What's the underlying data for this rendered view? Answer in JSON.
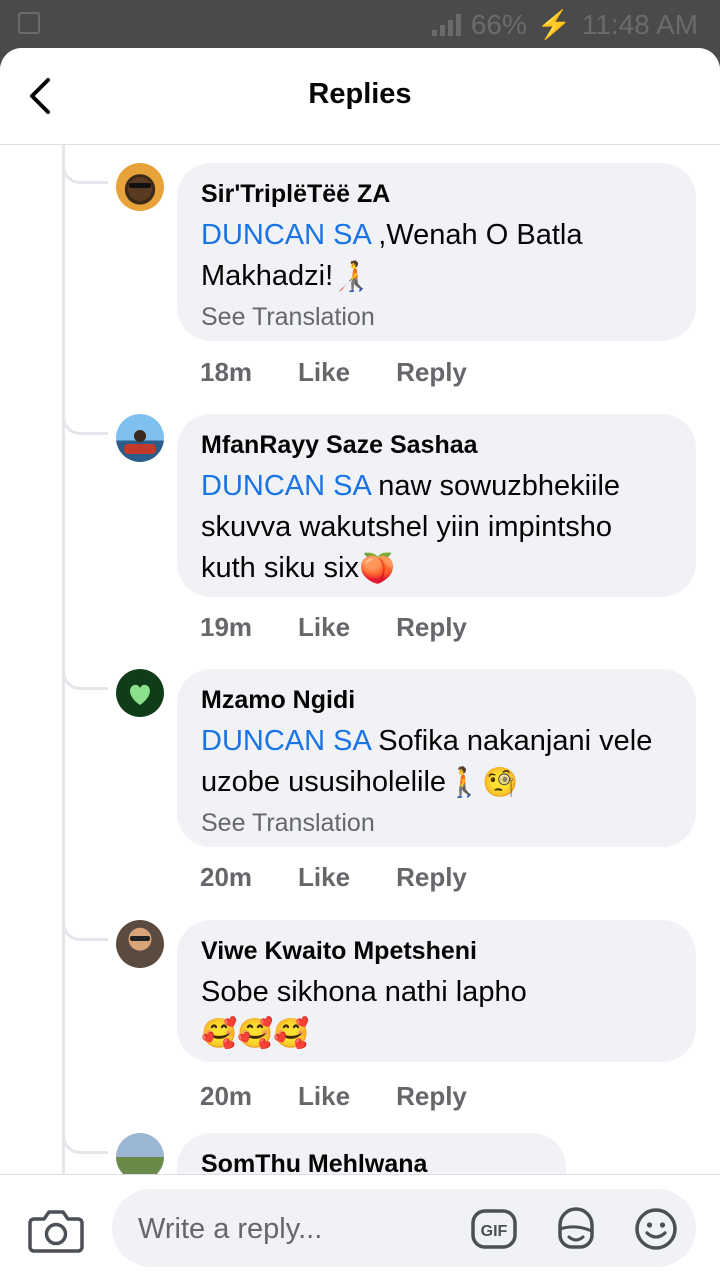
{
  "status_bar": {
    "battery": "66%",
    "time": "11:48 AM"
  },
  "header": {
    "title": "Replies"
  },
  "replies": [
    {
      "author": "Sir'TriplëTëë ZA",
      "mention": "DUNCAN SA",
      "text": " ,Wenah O Batla Makhadzi!",
      "emoji": "🧑‍🦯",
      "translation": "See Translation",
      "time": "18m",
      "like": "Like",
      "reply": "Reply"
    },
    {
      "author": "MfanRayy Saze Sashaa",
      "mention": "DUNCAN SA",
      "text": " naw sowuzbhekiile skuvva wakutshel yiin impintsho kuth siku six",
      "emoji": "🍑",
      "translation": "",
      "time": "19m",
      "like": "Like",
      "reply": "Reply"
    },
    {
      "author": "Mzamo Ngidi",
      "mention": "DUNCAN SA",
      "text": " Sofika nakanjani vele uzobe ususiholelile",
      "emoji": "🚶🧐",
      "translation": "See Translation",
      "time": "20m",
      "like": "Like",
      "reply": "Reply"
    },
    {
      "author": "Viwe Kwaito Mpetsheni",
      "mention": "",
      "text": "Sobe sikhona nathi lapho",
      "emoji": "🥰🥰🥰",
      "translation": "",
      "time": "20m",
      "like": "Like",
      "reply": "Reply"
    },
    {
      "author": "SomThu Mehlwana"
    }
  ],
  "composer": {
    "placeholder": "Write a reply...",
    "gif_label": "GIF"
  },
  "icons": {
    "back": "chevron-left-icon",
    "camera": "camera-icon",
    "gif": "gif-icon",
    "sticker": "sticker-icon",
    "emoji": "smiley-icon"
  },
  "colors": {
    "mention": "#1b74e4",
    "bubble": "#f0f2f5",
    "meta": "#65676b"
  }
}
